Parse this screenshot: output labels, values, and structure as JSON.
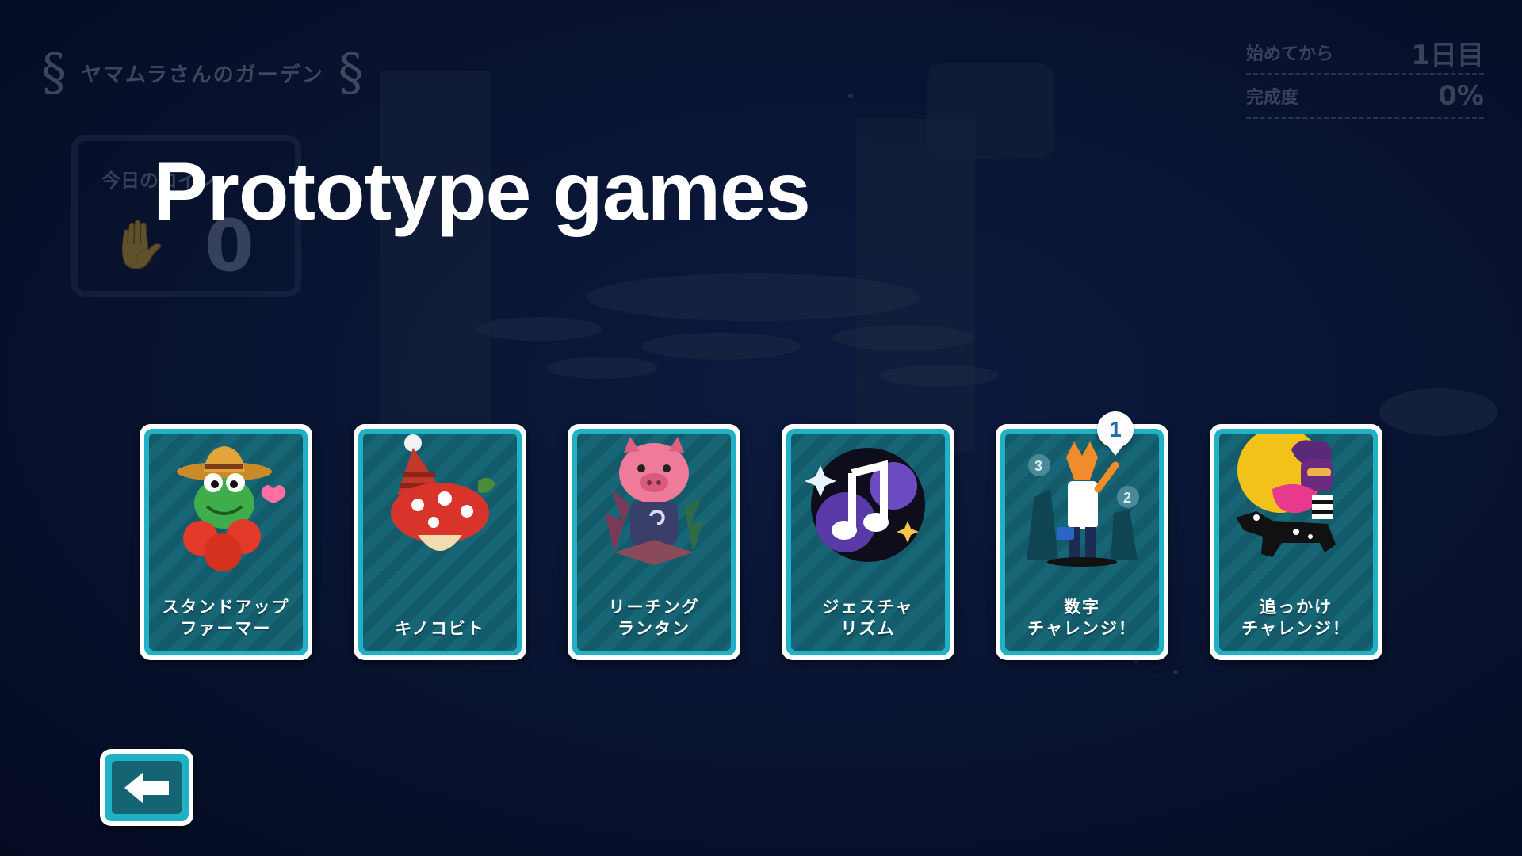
{
  "title": "Prototype games",
  "hud": {
    "garden_name": "ヤマムラさんのガーデン",
    "coins_label": "今日のコイン",
    "coins_value": "0",
    "days_label": "始めてから",
    "days_value": "1日目",
    "completion_label": "完成度",
    "completion_value": "0%"
  },
  "cards": [
    {
      "label": "スタンドアップ\nファーマー",
      "icon": "frog-farmer-icon"
    },
    {
      "label": "キノコビト",
      "icon": "mushroom-icon"
    },
    {
      "label": "リーチング\nランタン",
      "icon": "pig-lantern-icon"
    },
    {
      "label": "ジェスチャ\nリズム",
      "icon": "music-notes-icon"
    },
    {
      "label": "数字\nチャレンジ！",
      "icon": "fox-waving-icon",
      "badge": "1"
    },
    {
      "label": "追っかけ\nチャレンジ！",
      "icon": "chase-characters-icon"
    }
  ],
  "back_button": {
    "icon": "arrow-left-icon"
  },
  "colors": {
    "background": "#08132f",
    "card_border": "#20b2c4",
    "card_face": "#135b6b",
    "title": "#ffffff"
  }
}
